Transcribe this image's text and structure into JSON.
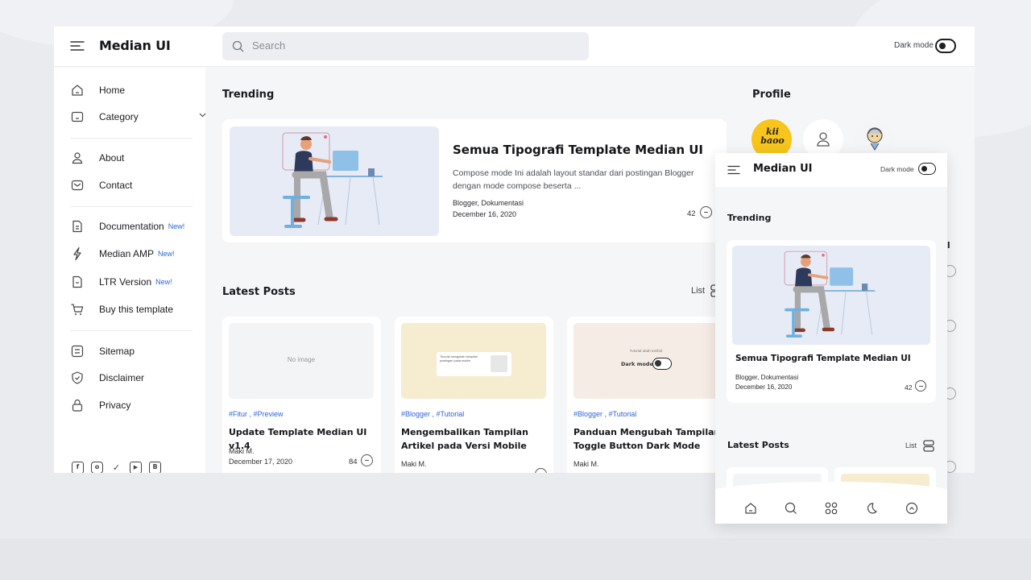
{
  "app": {
    "brand": "Median UI"
  },
  "search": {
    "placeholder": "Search"
  },
  "dark_mode": {
    "label": "Dark mode"
  },
  "sidebar": {
    "items": [
      {
        "label": "Home",
        "icon": "home-icon",
        "new": ""
      },
      {
        "label": "Category",
        "icon": "folder-icon",
        "new": ""
      },
      {
        "label": "About",
        "icon": "user-icon",
        "new": ""
      },
      {
        "label": "Contact",
        "icon": "mail-icon",
        "new": ""
      },
      {
        "label": "Documentation",
        "icon": "document-icon",
        "new": "New!"
      },
      {
        "label": "Median AMP",
        "icon": "lightning-icon",
        "new": "New!"
      },
      {
        "label": "LTR Version",
        "icon": "document-icon",
        "new": "New!"
      },
      {
        "label": "Buy this template",
        "icon": "cart-icon",
        "new": ""
      },
      {
        "label": "Sitemap",
        "icon": "list-icon",
        "new": ""
      },
      {
        "label": "Disclaimer",
        "icon": "shield-icon",
        "new": ""
      },
      {
        "label": "Privacy",
        "icon": "lock-icon",
        "new": ""
      }
    ],
    "social": [
      "facebook-icon",
      "instagram-icon",
      "twitter-icon",
      "youtube-icon",
      "blogger-icon"
    ]
  },
  "trending": {
    "heading": "Trending",
    "title": "Semua Tipografi Template Median UI",
    "desc": "Compose mode Ini adalah layout standar dari postingan Blogger dengan mode compose beserta ...",
    "labels": "Blogger, Dokumentasi",
    "date": "December 16, 2020",
    "comments": "42"
  },
  "latest": {
    "heading": "Latest Posts",
    "list_label": "List",
    "posts": [
      {
        "image_text": "No image",
        "tags": "#Fitur , #Preview",
        "title": "Update Template Median UI v1.4",
        "author": "Maki M.",
        "date": "December 17, 2020",
        "comments": "84"
      },
      {
        "image_text": "Tutorial mengubah tampilan postingan pada mobile",
        "tags": "#Blogger , #Tutorial",
        "title": "Mengembalikan Tampilan Artikel pada Versi Mobile",
        "author": "Maki M.",
        "date": "",
        "comments": ""
      },
      {
        "image_text": "Tutorial ubah tombol",
        "image_sub": "Dark mode",
        "tags": "#Blogger , #Tutorial",
        "title": "Panduan Mengubah Tampilan Toggle Button Dark Mode",
        "author": "Maki M.",
        "date": "",
        "comments": ""
      }
    ]
  },
  "profile": {
    "heading": "Profile",
    "avatar_text": "kii baoo"
  },
  "mobile": {
    "brand": "Median UI",
    "dark_mode": "Dark mode",
    "trending": "Trending",
    "card_title": "Semua Tipografi Template Median UI",
    "labels": "Blogger, Dokumentasi",
    "date": "December 16, 2020",
    "comments": "42",
    "latest": "Latest Posts",
    "list_label": "List",
    "bottom_nav": [
      "home-icon",
      "search-icon",
      "grid-icon",
      "moon-icon",
      "arrow-up-icon"
    ]
  },
  "colors": {
    "accent": "#2d67d8",
    "tag": "#2f63d6",
    "card_img_yellow": "#f6ecd0",
    "card_img_beige": "#f6ece6"
  }
}
